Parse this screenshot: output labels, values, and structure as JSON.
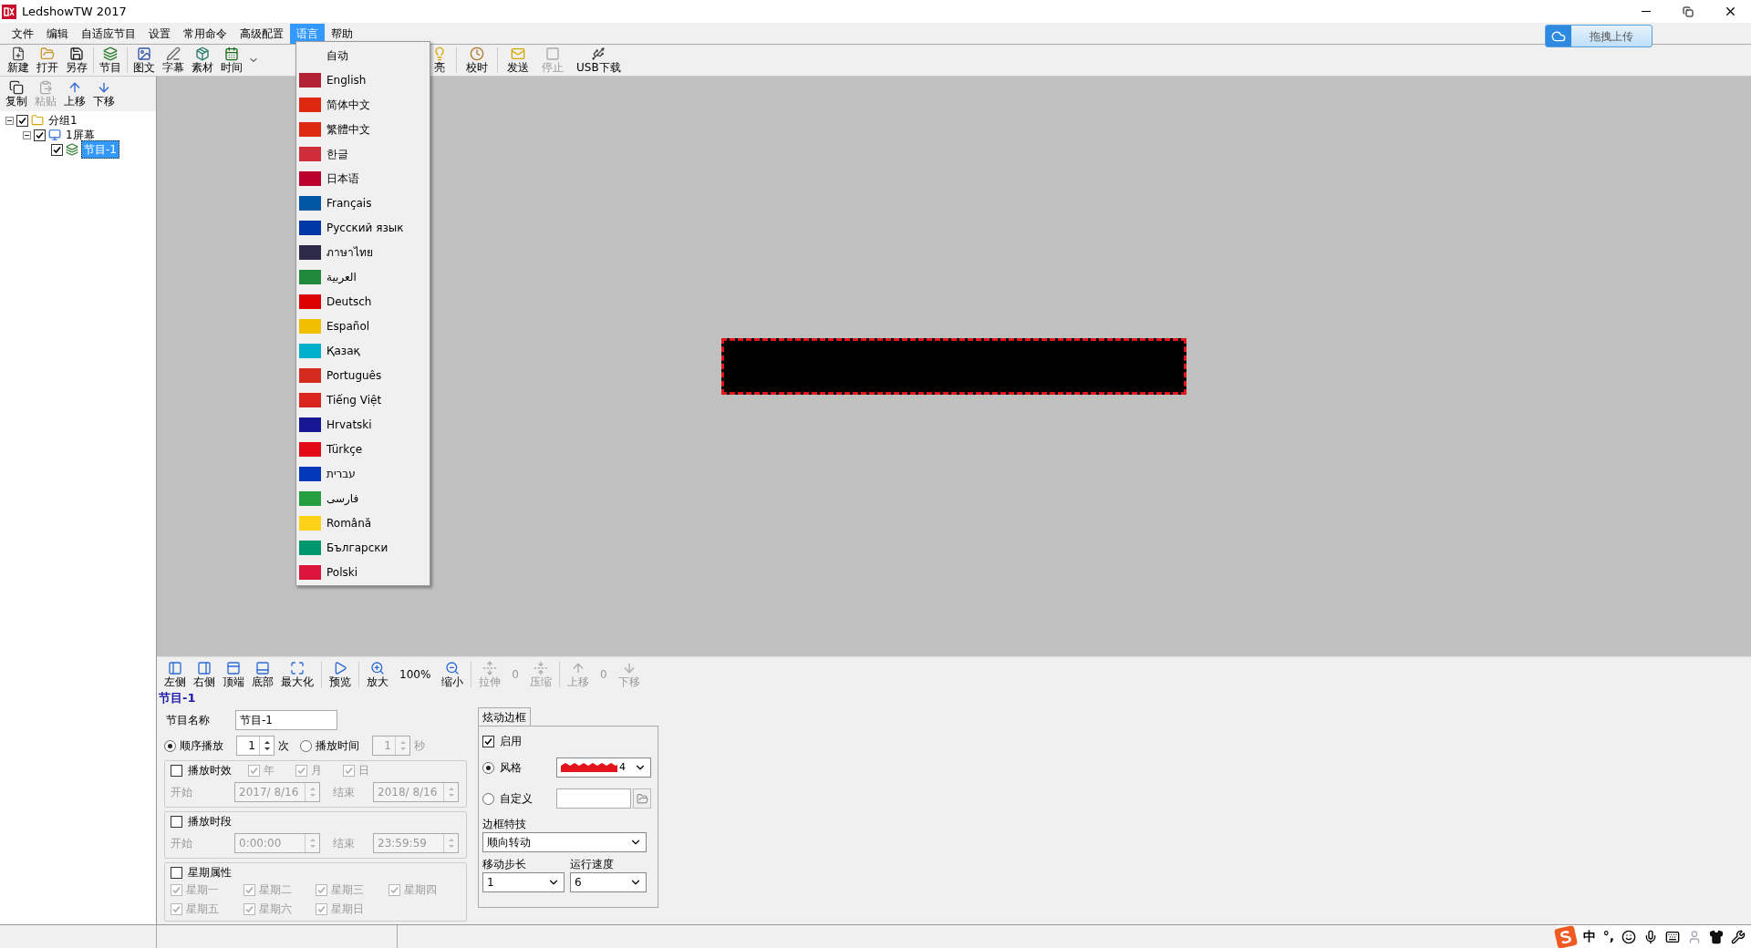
{
  "window": {
    "title": "LedshowTW 2017"
  },
  "menu": [
    {
      "label": "文件",
      "selected": false
    },
    {
      "label": "编辑",
      "selected": false
    },
    {
      "label": "自适应节目",
      "selected": false
    },
    {
      "label": "设置",
      "selected": false
    },
    {
      "label": "常用命令",
      "selected": false
    },
    {
      "label": "高级配置",
      "selected": false
    },
    {
      "label": "语言",
      "selected": true
    },
    {
      "label": "帮助",
      "selected": false
    }
  ],
  "upload_button": {
    "label": "拖拽上传"
  },
  "toolbar": [
    {
      "label": "新建",
      "disabled": false
    },
    {
      "label": "打开",
      "disabled": false
    },
    {
      "label": "另存",
      "disabled": false
    },
    {
      "label": "节目",
      "disabled": false
    },
    {
      "label": "图文",
      "disabled": false
    },
    {
      "label": "字幕",
      "disabled": false
    },
    {
      "label": "素材",
      "disabled": false
    },
    {
      "label": "时间",
      "disabled": false
    }
  ],
  "toolbar_right": [
    {
      "label": "亮",
      "disabled": false
    },
    {
      "label": "校时",
      "disabled": false
    },
    {
      "label": "发送",
      "disabled": false
    },
    {
      "label": "停止",
      "disabled": true
    },
    {
      "label": "USB下载",
      "disabled": false
    }
  ],
  "language_menu": [
    {
      "label": "自动"
    },
    {
      "label": "English",
      "color": "#b22234"
    },
    {
      "label": "简体中文",
      "color": "#de2910"
    },
    {
      "label": "繁體中文",
      "color": "#de2910"
    },
    {
      "label": "한글",
      "color": "#cd2e3a"
    },
    {
      "label": "日本语",
      "color": "#bc002d"
    },
    {
      "label": "Français",
      "color": "#0055a4"
    },
    {
      "label": "Русский язык",
      "color": "#0039a6"
    },
    {
      "label": "ภาษาไทย",
      "color": "#2d2a4a"
    },
    {
      "label": "العربية",
      "color": "#1f8a3b"
    },
    {
      "label": "Deutsch",
      "color": "#dd0000"
    },
    {
      "label": "Español",
      "color": "#f1bf00"
    },
    {
      "label": "Қазақ",
      "color": "#00afca"
    },
    {
      "label": "Português",
      "color": "#d52b1e"
    },
    {
      "label": "Tiếng Việt",
      "color": "#da251d"
    },
    {
      "label": "Hrvatski",
      "color": "#171796"
    },
    {
      "label": "Türkçe",
      "color": "#e30a17"
    },
    {
      "label": "עברית",
      "color": "#0038b8"
    },
    {
      "label": "فارسی",
      "color": "#239f40"
    },
    {
      "label": "Română",
      "color": "#fcd116"
    },
    {
      "label": "Български",
      "color": "#00966e"
    },
    {
      "label": "Polski",
      "color": "#dc143c"
    }
  ],
  "tree_toolbar": [
    {
      "label": "复制",
      "disabled": false
    },
    {
      "label": "粘贴",
      "disabled": true
    },
    {
      "label": "上移",
      "disabled": false
    },
    {
      "label": "下移",
      "disabled": false
    }
  ],
  "tree": [
    {
      "label": "分组1",
      "kind": "group",
      "checked": true,
      "expanded": true,
      "selected": false,
      "children": [
        {
          "label": "1屏幕",
          "kind": "screen",
          "checked": true,
          "expanded": true,
          "selected": false,
          "children": [
            {
              "label": "节目-1",
              "kind": "program",
              "checked": true,
              "selected": true
            }
          ]
        }
      ]
    }
  ],
  "canvas_toolbar": [
    {
      "kind": "button",
      "label": "左侧",
      "disabled": false
    },
    {
      "kind": "button",
      "label": "右侧",
      "disabled": false
    },
    {
      "kind": "button",
      "label": "顶端",
      "disabled": false
    },
    {
      "kind": "button",
      "label": "底部",
      "disabled": false
    },
    {
      "kind": "button",
      "label": "最大化",
      "disabled": false
    },
    {
      "kind": "separator"
    },
    {
      "kind": "button",
      "label": "预览",
      "disabled": false
    },
    {
      "kind": "separator"
    },
    {
      "kind": "button",
      "label": "放大",
      "disabled": false
    },
    {
      "kind": "value",
      "label": "100%"
    },
    {
      "kind": "button",
      "label": "缩小",
      "disabled": false
    },
    {
      "kind": "separator"
    },
    {
      "kind": "button",
      "label": "拉伸",
      "disabled": true
    },
    {
      "kind": "value",
      "label": "0"
    },
    {
      "kind": "button",
      "label": "压缩",
      "disabled": true
    },
    {
      "kind": "separator"
    },
    {
      "kind": "button",
      "label": "上移",
      "disabled": true
    },
    {
      "kind": "value",
      "label": "0"
    },
    {
      "kind": "button",
      "label": "下移",
      "disabled": true
    }
  ],
  "program_title": "节目-1",
  "form": {
    "name_label": "节目名称",
    "name_value": "节目-1",
    "play_modes": [
      {
        "label": "顺序播放",
        "selected": true,
        "value": "1",
        "unit": "次"
      },
      {
        "label": "播放时间",
        "selected": false,
        "value": "1",
        "unit": "秒"
      }
    ],
    "validity": {
      "label": "播放时效",
      "checked": false,
      "options": [
        {
          "label": "年",
          "checked": true
        },
        {
          "label": "月",
          "checked": true
        },
        {
          "label": "日",
          "checked": true
        }
      ],
      "start_label": "开始",
      "start": "2017/ 8/16",
      "end_label": "结束",
      "end": "2018/ 8/16"
    },
    "period": {
      "label": "播放时段",
      "checked": false,
      "start_label": "开始",
      "start": "0:00:00",
      "end_label": "结束",
      "end": "23:59:59"
    },
    "week": {
      "label": "星期属性",
      "checked": false,
      "days": [
        {
          "label": "星期一",
          "checked": true
        },
        {
          "label": "星期二",
          "checked": true
        },
        {
          "label": "星期三",
          "checked": true
        },
        {
          "label": "星期四",
          "checked": true
        },
        {
          "label": "星期五",
          "checked": true
        },
        {
          "label": "星期六",
          "checked": true
        },
        {
          "label": "星期日",
          "checked": true
        }
      ]
    }
  },
  "border_panel": {
    "tab": "炫动边框",
    "enable": {
      "label": "启用",
      "checked": true
    },
    "sources": [
      {
        "kind": "pattern",
        "label": "风格",
        "selected": true,
        "value": "4"
      },
      {
        "kind": "file",
        "label": "自定义",
        "selected": false
      }
    ],
    "effect_label": "边框特技",
    "effect": "顺向转动",
    "step_label": "移动步长",
    "step": "1",
    "speed_label": "运行速度",
    "speed": "6"
  },
  "tray": [
    {
      "kind": "logo"
    },
    {
      "kind": "text",
      "label": "中"
    },
    {
      "kind": "text",
      "label": "°,"
    },
    {
      "kind": "smiley"
    },
    {
      "kind": "mic"
    },
    {
      "kind": "keyboard"
    },
    {
      "kind": "user"
    },
    {
      "kind": "shirt"
    },
    {
      "kind": "wrench"
    }
  ]
}
